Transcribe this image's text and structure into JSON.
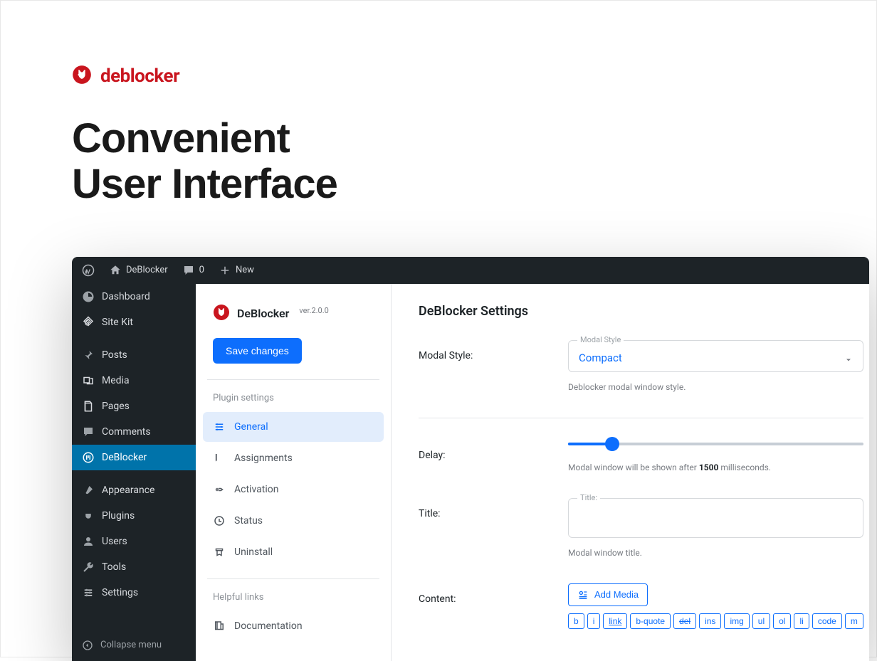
{
  "brand": {
    "name": "deblocker"
  },
  "hero": {
    "line1": "Convenient",
    "line2": "User Interface"
  },
  "adminbar": {
    "site": "DeBlocker",
    "comments": "0",
    "new": "New"
  },
  "sidebar": {
    "items": [
      {
        "label": "Dashboard",
        "icon": "dashboard"
      },
      {
        "label": "Site Kit",
        "icon": "sitekit"
      },
      {
        "label": "Posts",
        "icon": "pin"
      },
      {
        "label": "Media",
        "icon": "media"
      },
      {
        "label": "Pages",
        "icon": "pages"
      },
      {
        "label": "Comments",
        "icon": "comment"
      },
      {
        "label": "DeBlocker",
        "icon": "block",
        "active": true
      },
      {
        "label": "Appearance",
        "icon": "brush"
      },
      {
        "label": "Plugins",
        "icon": "plug"
      },
      {
        "label": "Users",
        "icon": "user"
      },
      {
        "label": "Tools",
        "icon": "wrench"
      },
      {
        "label": "Settings",
        "icon": "settings"
      }
    ],
    "collapse": "Collapse menu"
  },
  "pluginSidebar": {
    "title": "DeBlocker",
    "version": "ver.2.0.0",
    "save": "Save changes",
    "section1": "Plugin settings",
    "nav": [
      {
        "label": "General",
        "active": true
      },
      {
        "label": "Assignments"
      },
      {
        "label": "Activation"
      },
      {
        "label": "Status"
      },
      {
        "label": "Uninstall"
      }
    ],
    "section2": "Helpful links",
    "links": [
      {
        "label": "Documentation"
      }
    ]
  },
  "settings": {
    "title": "DeBlocker Settings",
    "modalStyle": {
      "label": "Modal Style:",
      "legend": "Modal Style",
      "value": "Compact",
      "help": "Deblocker modal window style."
    },
    "delay": {
      "label": "Delay:",
      "help_pre": "Modal window will be shown after ",
      "value": "1500",
      "help_post": " milliseconds."
    },
    "titleField": {
      "label": "Title:",
      "legend": "Title:",
      "value": "",
      "help": "Modal window title."
    },
    "content": {
      "label": "Content:",
      "addMedia": "Add Media",
      "toolbar": [
        "b",
        "i",
        "link",
        "b-quote",
        "del",
        "ins",
        "img",
        "ul",
        "ol",
        "li",
        "code",
        "m"
      ]
    }
  }
}
